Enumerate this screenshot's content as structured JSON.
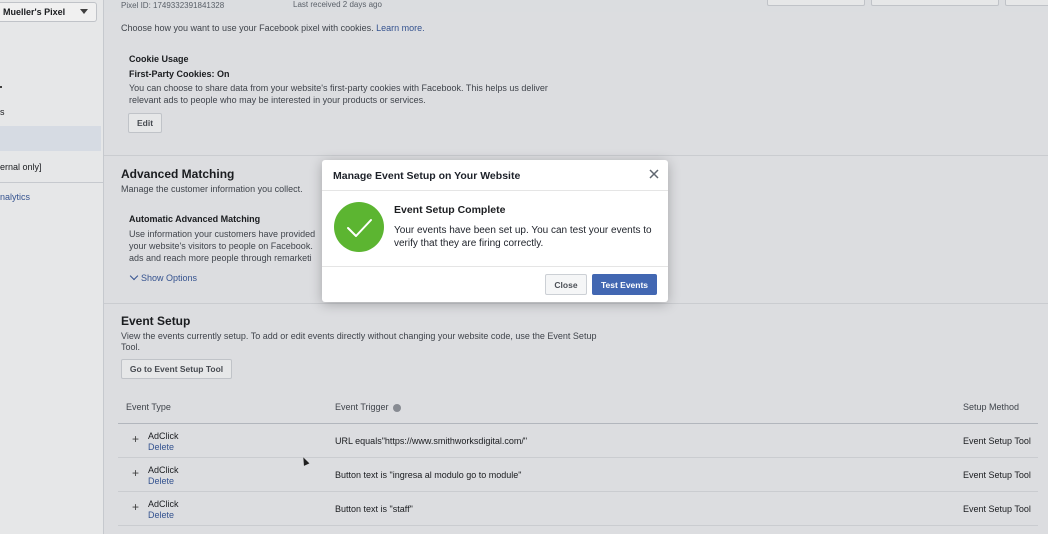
{
  "header": {
    "pixel_id": "Pixel ID: 1749332391841328",
    "last_received": "Last received 2 days ago"
  },
  "sidebar": {
    "pixel_name": "Mueller's Pixel",
    "items": [
      {
        "label": "s"
      },
      {
        "label": "ernal only]"
      },
      {
        "label": "nalytics"
      }
    ]
  },
  "cookies": {
    "intro": "Choose how you want to use your Facebook pixel with cookies.",
    "learn_more": "Learn more.",
    "title": "Cookie Usage",
    "status": "First-Party Cookies: On",
    "desc1": "You can choose to share data from your website's first-party cookies with Facebook. This helps us deliver",
    "desc2": "relevant ads to people who may be interested in your products or services.",
    "edit_label": "Edit"
  },
  "advanced_matching": {
    "title": "Advanced Matching",
    "subtitle": "Manage the customer information you collect.",
    "auto_title": "Automatic Advanced Matching",
    "desc1": "Use information your customers have provided",
    "desc2": "your website's visitors to people on Facebook.",
    "desc3": "ads and reach more people through remarketi",
    "show_options": "Show Options"
  },
  "event_setup": {
    "title": "Event Setup",
    "desc1": "View the events currently setup. To add or edit events directly without changing your website code, use the Event Setup",
    "desc2": "Tool.",
    "tool_button": "Go to Event Setup Tool",
    "columns": {
      "type": "Event Type",
      "trigger": "Event Trigger",
      "method": "Setup Method"
    },
    "rows": [
      {
        "type": "AdClick",
        "delete": "Delete",
        "trigger": "URL equals\"https://www.smithworksdigital.com/\"",
        "method": "Event Setup Tool"
      },
      {
        "type": "AdClick",
        "delete": "Delete",
        "trigger": "Button text is \"ingresa al modulo go to module\"",
        "method": "Event Setup Tool"
      },
      {
        "type": "AdClick",
        "delete": "Delete",
        "trigger": "Button text is \"staff\"",
        "method": "Event Setup Tool"
      }
    ]
  },
  "modal": {
    "title": "Manage Event Setup on Your Website",
    "success_title": "Event Setup Complete",
    "success_body": "Your events have been set up. You can test your events to verify that they are firing correctly.",
    "close_label": "Close",
    "test_label": "Test Events"
  },
  "colors": {
    "primary": "#4267b2",
    "success": "#5cb531",
    "link": "#385898"
  }
}
